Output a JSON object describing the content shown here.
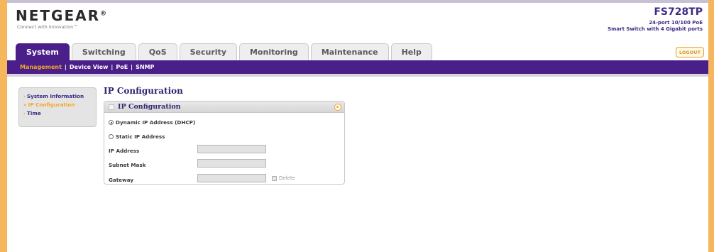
{
  "brand": {
    "logo_text": "NETGEAR",
    "logo_mark": "®",
    "tagline": "Connect with Innovation™",
    "model": "FS728TP",
    "model_desc_line1": "24-port 10/100 PoE",
    "model_desc_line2": "Smart Switch with 4 Gigabit ports"
  },
  "tabs": [
    {
      "label": "System",
      "active": true
    },
    {
      "label": "Switching",
      "active": false
    },
    {
      "label": "QoS",
      "active": false
    },
    {
      "label": "Security",
      "active": false
    },
    {
      "label": "Monitoring",
      "active": false
    },
    {
      "label": "Maintenance",
      "active": false
    },
    {
      "label": "Help",
      "active": false
    }
  ],
  "logout_label": "LOGOUT",
  "subnav": [
    {
      "label": "Management",
      "active": true
    },
    {
      "label": "Device View",
      "active": false
    },
    {
      "label": "PoE",
      "active": false
    },
    {
      "label": "SNMP",
      "active": false
    }
  ],
  "leftmenu": [
    {
      "label": "System Information",
      "active": false
    },
    {
      "label": "IP Configuration",
      "active": true
    },
    {
      "label": "Time",
      "active": false
    }
  ],
  "page_title": "IP Configuration",
  "panel": {
    "title": "IP Configuration",
    "dhcp_label": "Dynamic IP Address (DHCP)",
    "static_label": "Static IP Address",
    "selected_mode": "dhcp",
    "ip_label": "IP Address",
    "ip_value": "",
    "mask_label": "Subnet Mask",
    "mask_value": "",
    "gateway_label": "Gateway",
    "gateway_value": "",
    "delete_label": "Delete"
  },
  "colors": {
    "accent_purple": "#4a1f8a",
    "accent_orange": "#f6a623",
    "frame_orange": "#f5b65c"
  },
  "icons": {
    "help": "help-circle-icon",
    "panel_toggle": "collapse-box-icon",
    "menu_arrow": "arrow-right-icon"
  }
}
